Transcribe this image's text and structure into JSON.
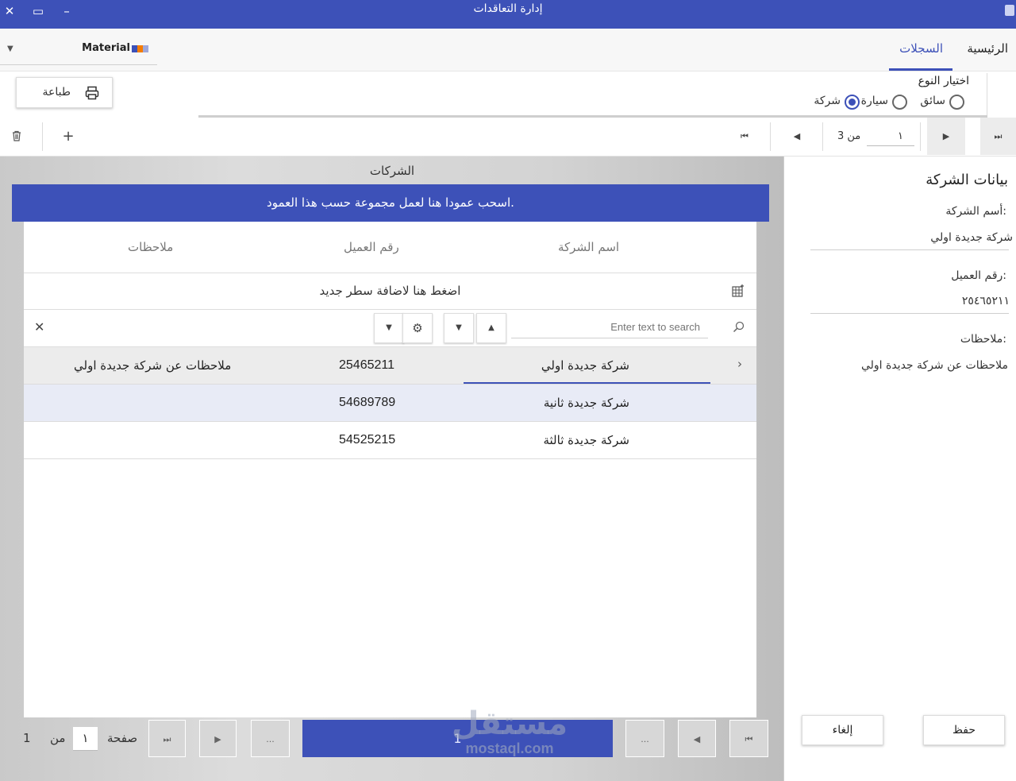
{
  "window": {
    "title": "إدارة التعاقدات",
    "close_glyph": "✕",
    "maximize_glyph": "▭",
    "minimize_glyph": "–"
  },
  "ribbon": {
    "tabs": [
      {
        "label": "الرئيسية",
        "active": false
      },
      {
        "label": "السجلات",
        "active": true
      }
    ],
    "theme_name": "Material",
    "theme_colors": [
      "#3d51b8",
      "#f57c00",
      "#9fa8da"
    ],
    "accent": "#3d51b8"
  },
  "toolbar": {
    "print_label": "طباعة",
    "type_title": "اختيار النوع",
    "type_options": [
      {
        "label": "سائق",
        "selected": false
      },
      {
        "label": "سيارة",
        "selected": false
      },
      {
        "label": "شركة",
        "selected": true
      }
    ]
  },
  "navigator": {
    "position": "١",
    "of_text": "من 3",
    "add_glyph": "+",
    "delete_icon": "trash-icon"
  },
  "grid": {
    "title": "الشركات",
    "group_panel_text": "اسحب عمودا هنا لعمل مجموعة حسب هذا العمود.",
    "columns": [
      "اسم الشركة",
      "رقم العميل",
      "ملاحظات"
    ],
    "new_row_text": "اضغط هنا لاضافة سطر جديد",
    "search_placeholder": "Enter text to search",
    "rows": [
      {
        "name": "شركة جديدة اولي",
        "number": "25465211",
        "notes": "ملاحظات عن شركة جديدة اولي"
      },
      {
        "name": "شركة جديدة ثانية",
        "number": "54689789",
        "notes": ""
      },
      {
        "name": "شركة جديدة ثالثة",
        "number": "54525215",
        "notes": ""
      }
    ],
    "selected_row_index": 0
  },
  "pager": {
    "page_label": "صفحة",
    "page_value": "١",
    "of_label": "من",
    "total_pages": "1",
    "current_page": "1",
    "ellipsis": "..."
  },
  "details": {
    "title": "بيانات الشركة",
    "name_label": "أسم الشركة:",
    "name_value": "شركة جديدة اولي",
    "number_label": "رقم العميل:",
    "number_value": "٢٥٤٦٥٢١١",
    "notes_label": "ملاحظات:",
    "notes_value": "ملاحظات عن شركة جديدة اولي",
    "save_label": "حفظ",
    "cancel_label": "إلغاء"
  },
  "watermark": {
    "text": "مستقل",
    "url": "mostaql.com"
  }
}
